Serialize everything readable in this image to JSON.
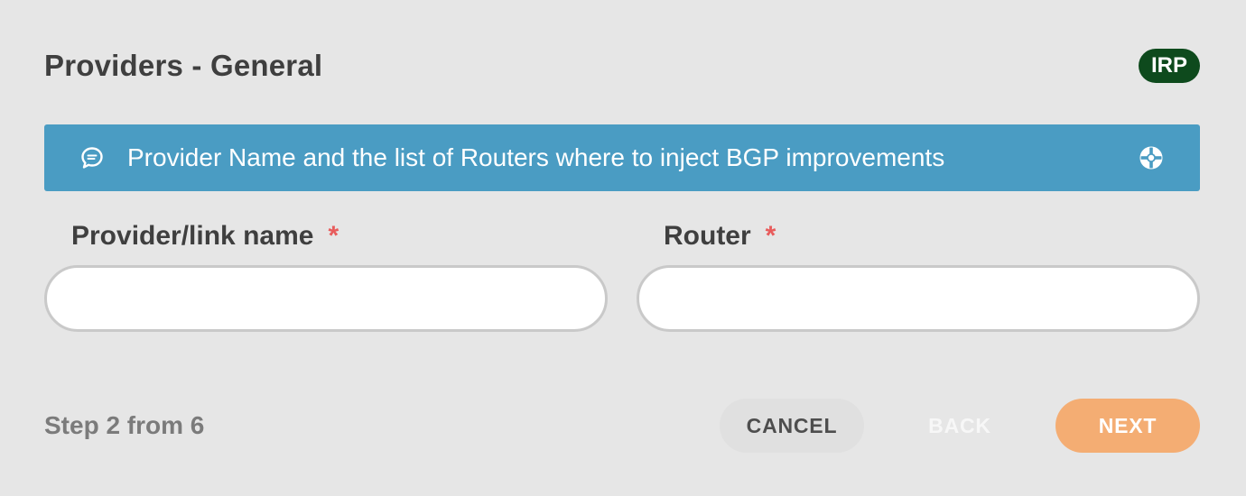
{
  "header": {
    "title": "Providers - General",
    "badge": "IRP"
  },
  "banner": {
    "text": "Provider Name and the list of Routers where to inject BGP improvements",
    "icon_left": "chat-bubble-icon",
    "icon_right": "help-lifebuoy-icon",
    "color": "#4a9cc3"
  },
  "form": {
    "provider_name": {
      "label": "Provider/link name",
      "required_mark": "*",
      "value": ""
    },
    "router": {
      "label": "Router",
      "required_mark": "*",
      "value": ""
    }
  },
  "footer": {
    "step": "Step 2 from 6",
    "cancel_label": "CANCEL",
    "back_label": "BACK",
    "next_label": "NEXT",
    "next_color": "#f4ad73"
  },
  "colors": {
    "badge": "#0e4a1d",
    "required": "#e85c5c",
    "background": "#e6e6e6"
  }
}
